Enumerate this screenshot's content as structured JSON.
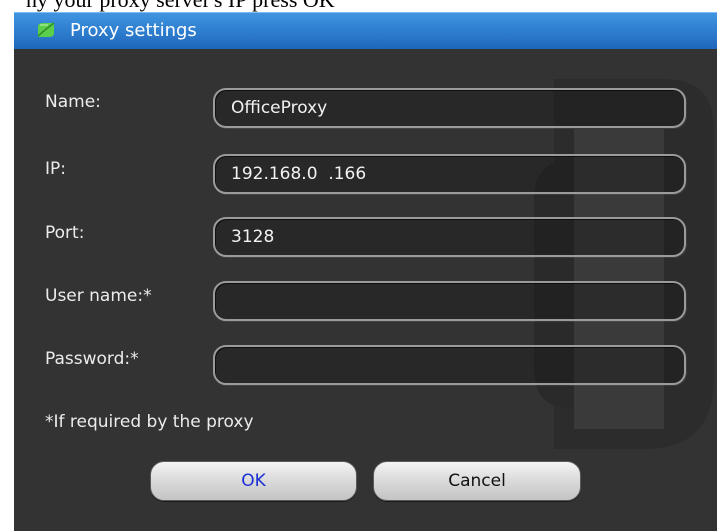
{
  "background_text": "ny your proxy server's IP press OK",
  "window": {
    "title": "Proxy settings",
    "icon": "app-logo-icon"
  },
  "fields": {
    "name": {
      "label": "Name:",
      "value": "OfficeProxy"
    },
    "ip": {
      "label": "IP:",
      "value": "192.168.0  .166"
    },
    "port": {
      "label": "Port:",
      "value": "3128"
    },
    "username": {
      "label": "User name:*",
      "value": ""
    },
    "password": {
      "label": "Password:*",
      "value": ""
    }
  },
  "note": "*If required by the proxy",
  "buttons": {
    "ok": "OK",
    "cancel": "Cancel"
  },
  "colors": {
    "titlebar": "#2f7fd0",
    "body": "#333333",
    "ok_text": "#1a2fd6"
  }
}
